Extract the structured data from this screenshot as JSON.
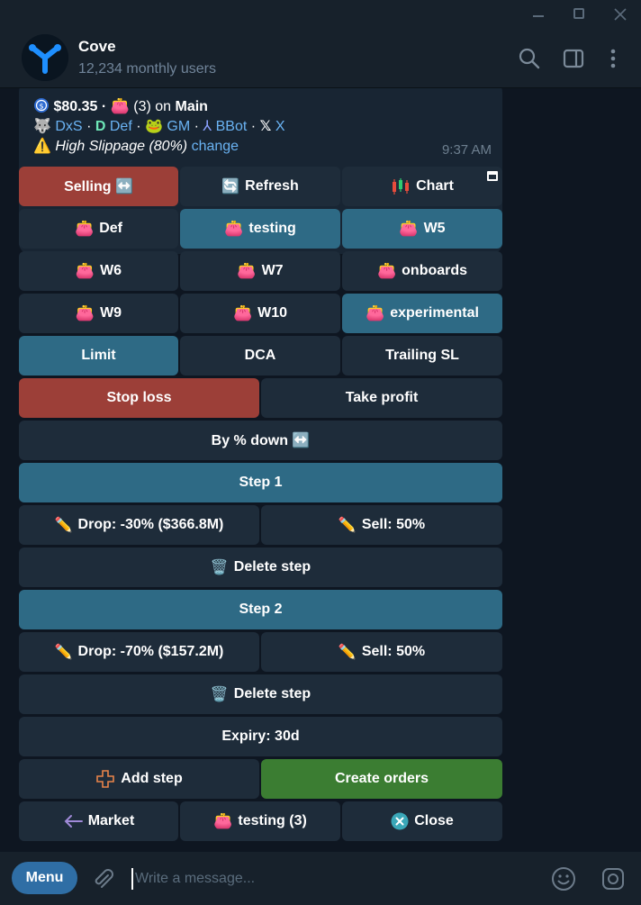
{
  "chat": {
    "title": "Cove",
    "subtitle": "12,234 monthly users"
  },
  "message": {
    "balance": "$80.35 ·",
    "wallet_count": "(3) on",
    "wallet_name": "Main",
    "links": [
      "DxS",
      "Def",
      "GM",
      "BBot",
      "X"
    ],
    "separator": "·",
    "slippage_text": "High Slippage (80%)",
    "slippage_action": "change",
    "time": "9:37 AM"
  },
  "keyboard": {
    "row1": [
      "Selling ↔️",
      "Refresh",
      "Chart"
    ],
    "row2": [
      "Def",
      "testing",
      "W5"
    ],
    "row3": [
      "W6",
      "W7",
      "onboards"
    ],
    "row4": [
      "W9",
      "W10",
      "experimental"
    ],
    "row5": [
      "Limit",
      "DCA",
      "Trailing SL"
    ],
    "row6": [
      "Stop loss",
      "Take profit"
    ],
    "by_pct": "By % down ↔️",
    "step1": "Step 1",
    "step1_drop": "Drop: -30% ($366.8M)",
    "step1_sell": "Sell: 50%",
    "delete_step": "Delete step",
    "step2": "Step 2",
    "step2_drop": "Drop: -70% ($157.2M)",
    "step2_sell": "Sell: 50%",
    "expiry": "Expiry: 30d",
    "add_step": "Add step",
    "create_orders": "Create orders",
    "market": "Market",
    "testing_count": "testing (3)",
    "close": "Close"
  },
  "input": {
    "menu_label": "Menu",
    "placeholder": "Write a message..."
  },
  "colors": {
    "button": "#1e2c3a",
    "button_active": "#2e6a85",
    "button_red": "#9c3f38",
    "button_green": "#3b7d32",
    "link": "#6ab3f3"
  }
}
